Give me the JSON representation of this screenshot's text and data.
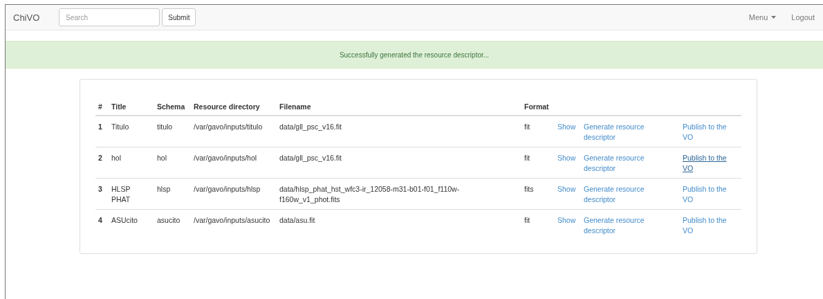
{
  "navbar": {
    "brand": "ChiVO",
    "search": {
      "placeholder": "Search"
    },
    "submit": "Submit",
    "menu": "Menu",
    "logout": "Logout"
  },
  "alert": {
    "message": "Successfully generated the resource descriptor..."
  },
  "table": {
    "columns": [
      "#",
      "Title",
      "Schema",
      "Resource directory",
      "Filename",
      "Format"
    ],
    "rows": [
      {
        "index": "1",
        "title": "Titulo",
        "schema": "titulo",
        "directory": "/var/gavo/inputs/titulo",
        "filename": "data/gll_psc_v16.fit",
        "format": "fit",
        "show": "Show",
        "generate": "Generate resource descriptor",
        "publish": "Publish to the VO",
        "publish_hovered": false
      },
      {
        "index": "2",
        "title": "hol",
        "schema": "hol",
        "directory": "/var/gavo/inputs/hol",
        "filename": "data/gll_psc_v16.fit",
        "format": "fit",
        "show": "Show",
        "generate": "Generate resource descriptor",
        "publish": "Publish to the VO",
        "publish_hovered": true
      },
      {
        "index": "3",
        "title": "HLSP PHAT",
        "schema": "hlsp",
        "directory": "/var/gavo/inputs/hlsp",
        "filename": "data/hlsp_phat_hst_wfc3-ir_12058-m31-b01-f01_f110w-f160w_v1_phot.fits",
        "format": "fits",
        "show": "Show",
        "generate": "Generate resource descriptor",
        "publish": "Publish to the VO",
        "publish_hovered": false
      },
      {
        "index": "4",
        "title": "ASUcito",
        "schema": "asucito",
        "directory": "/var/gavo/inputs/asucito",
        "filename": "data/asu.fit",
        "format": "fit",
        "show": "Show",
        "generate": "Generate resource descriptor",
        "publish": "Publish to the VO",
        "publish_hovered": false
      }
    ]
  }
}
